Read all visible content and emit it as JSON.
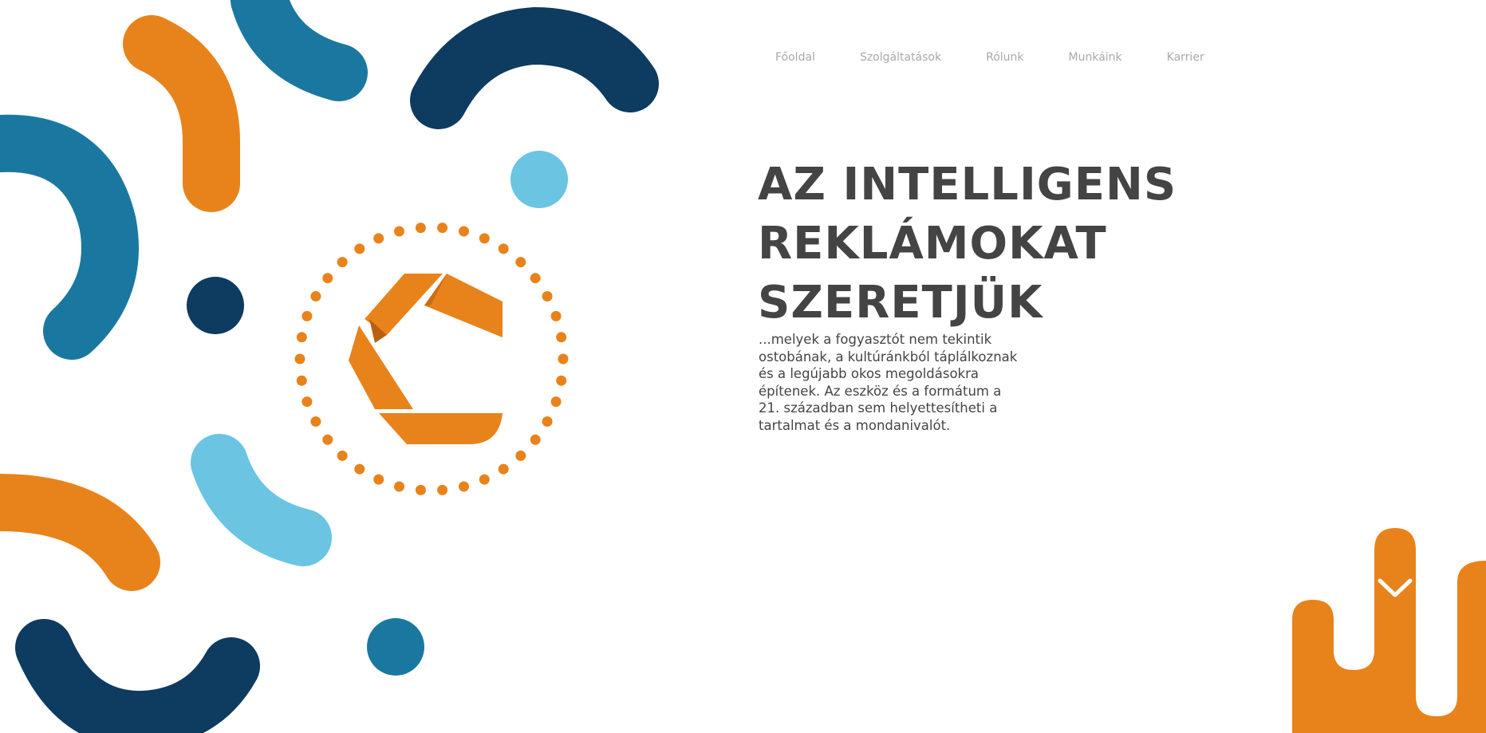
{
  "nav": {
    "items": [
      {
        "label": "Főoldal"
      },
      {
        "label": "Szolgáltatások"
      },
      {
        "label": "Rólunk"
      },
      {
        "label": "Munkáink"
      },
      {
        "label": "Karrier"
      }
    ]
  },
  "hero": {
    "title_lines": [
      "AZ INTELLIGENS",
      "REKLÁMOKAT",
      "SZERETJÜK"
    ],
    "description": "...melyek a fogyasztót nem tekintik ostobának, a kultúránkból táplálkoznak és a legújabb okos megoldásokra építenek. Az eszköz és a formátum a 21. században sem helyettesítheti a tartalmat és a mondanivalót."
  },
  "icons": {
    "logo": "c-aperture-logo",
    "scroll": "chevron-down-icon"
  },
  "colors": {
    "orange": "#E8831B",
    "teal": "#1A78A0",
    "navy": "#0E3B60",
    "light_blue": "#6AC4E2",
    "text": "#444444",
    "nav_text": "#A9A9A9"
  }
}
